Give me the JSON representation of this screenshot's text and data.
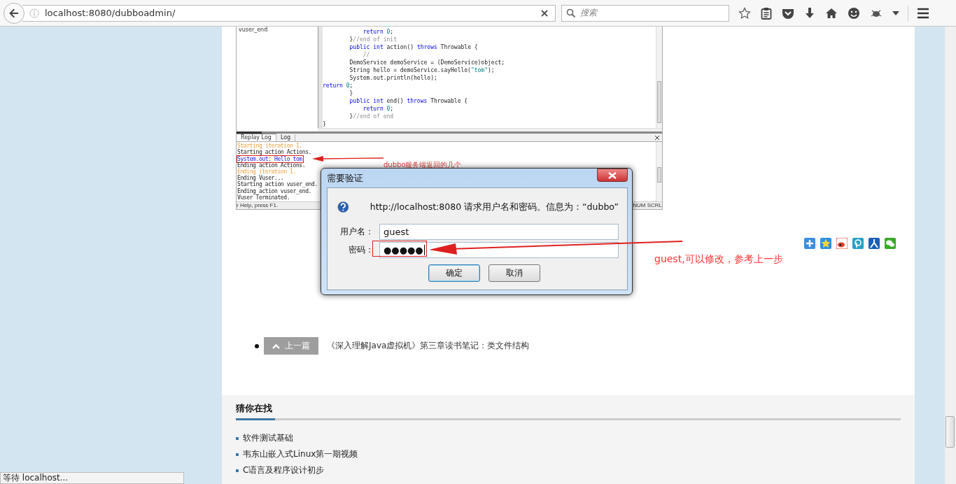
{
  "browser": {
    "url": "localhost:8080/dubboadmin/",
    "search_placeholder": "搜索"
  },
  "article_image": {
    "tree_item": "vuser_end",
    "code": [
      {
        "parts": [
          {
            "text": "            return ",
            "kind": "keyword"
          },
          {
            "text": "0",
            "kind": "number"
          },
          {
            "text": ";",
            "kind": "plain"
          }
        ]
      },
      {
        "parts": [
          {
            "text": "        }",
            "kind": "plain"
          },
          {
            "text": "//end of init",
            "kind": "comment"
          }
        ]
      },
      {
        "parts": [
          {
            "text": "        public int",
            "kind": "keyword"
          },
          {
            "text": " action() ",
            "kind": "plain"
          },
          {
            "text": "throws",
            "kind": "keyword"
          },
          {
            "text": " Throwable {",
            "kind": "plain"
          }
        ]
      },
      {
        "parts": [
          {
            "text": "            //",
            "kind": "comment"
          }
        ]
      },
      {
        "parts": [
          {
            "text": "        DemoService demoService = (DemoService)object;",
            "kind": "plain"
          }
        ]
      },
      {
        "parts": [
          {
            "text": "        String hello = demoService.sayHello(",
            "kind": "plain"
          },
          {
            "text": "\"tom\"",
            "kind": "string"
          },
          {
            "text": ");",
            "kind": "plain"
          }
        ]
      },
      {
        "parts": [
          {
            "text": "        System.out.println(hello);",
            "kind": "plain"
          }
        ]
      },
      {
        "parts": [
          {
            "text": "return ",
            "kind": "keyword"
          },
          {
            "text": "0",
            "kind": "number"
          },
          {
            "text": ";",
            "kind": "plain"
          }
        ]
      },
      {
        "parts": [
          {
            "text": "        }",
            "kind": "plain"
          }
        ]
      },
      {
        "parts": [
          {
            "text": "        public int",
            "kind": "keyword"
          },
          {
            "text": " end() ",
            "kind": "plain"
          },
          {
            "text": "throws",
            "kind": "keyword"
          },
          {
            "text": " Throwable {",
            "kind": "plain"
          }
        ]
      },
      {
        "parts": [
          {
            "text": "            return ",
            "kind": "keyword"
          },
          {
            "text": "0",
            "kind": "number"
          },
          {
            "text": ";",
            "kind": "plain"
          }
        ]
      },
      {
        "parts": [
          {
            "text": "        }",
            "kind": "plain"
          },
          {
            "text": "//end of end",
            "kind": "comment"
          }
        ]
      },
      {
        "parts": [
          {
            "text": "}",
            "kind": "plain"
          }
        ]
      }
    ],
    "log_tabs": [
      {
        "label": "Replay Log",
        "selected": true
      },
      {
        "label": "Log",
        "selected": false
      }
    ],
    "log": [
      {
        "text": "Starting iteration 1.",
        "kind": "iteration"
      },
      {
        "text": "Starting action Actions.",
        "kind": "plain"
      },
      {
        "text": "System.out: Hello tom",
        "kind": "output"
      },
      {
        "text": "Ending action Actions.",
        "kind": "plain"
      },
      {
        "text": "Ending iteration 1.",
        "kind": "iteration"
      },
      {
        "text": "Ending Vuser...",
        "kind": "plain"
      },
      {
        "text": "Starting action vuser_end.",
        "kind": "plain"
      },
      {
        "text": "Ending action vuser_end.",
        "kind": "plain"
      },
      {
        "text": "Vuser Terminated.",
        "kind": "plain"
      }
    ],
    "status_left": "r Help, press F1.",
    "status_right": "NUM SCRL",
    "callout": "dubbo服务端返回的几个"
  },
  "dialog": {
    "title": "需要验证",
    "message": "http://localhost:8080 请求用户名和密码。信息为：“dubbo”",
    "fields": [
      {
        "label": "用户名：",
        "value": "guest"
      },
      {
        "label": "密码：",
        "value": "●●●●●"
      }
    ],
    "buttons": [
      {
        "label": "确定",
        "default": true
      },
      {
        "label": "取消",
        "default": false
      }
    ]
  },
  "annotation": "guest,可以修改，参考上一步",
  "prev_post": {
    "label": "上一篇",
    "title": "《深入理解Java虚拟机》第三章读书笔记：类文件结构"
  },
  "related": {
    "heading": "猜你在找",
    "items": [
      "软件测试基础",
      "韦东山嵌入式Linux第一期视频",
      "C语言及程序设计初步"
    ]
  },
  "status": "等待 localhost..."
}
